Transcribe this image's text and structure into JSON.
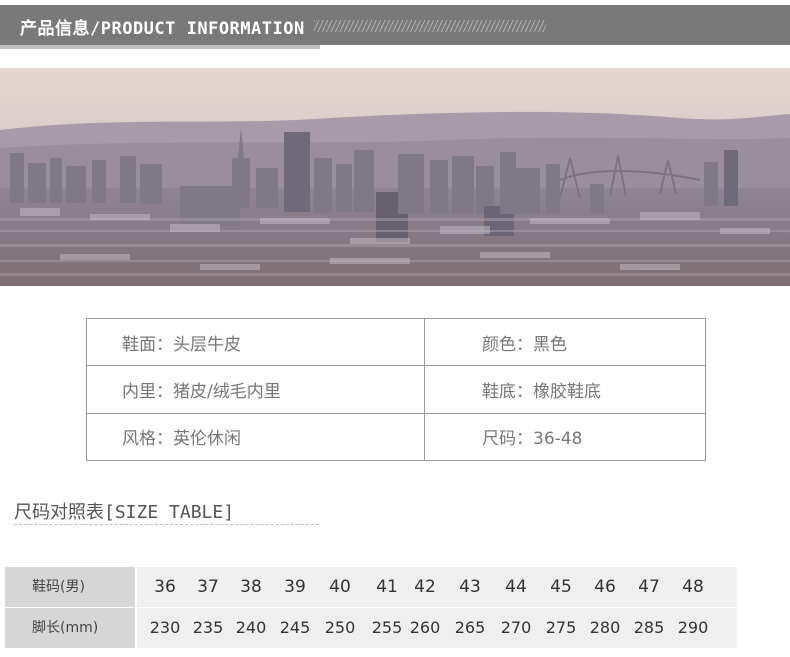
{
  "header": {
    "title": "产品信息/PRODUCT INFORMATION"
  },
  "info": {
    "rows": [
      {
        "left": "鞋面：头层牛皮",
        "right": "颜色：黑色"
      },
      {
        "left": "内里：猪皮/绒毛内里",
        "right": "鞋底：橡胶鞋底"
      },
      {
        "left": "风格：英伦休闲",
        "right": "尺码：36-48"
      }
    ]
  },
  "size_table": {
    "title": "尺码对照表[SIZE TABLE]",
    "row1_label": "鞋码(男)",
    "row2_label": "脚长(mm)",
    "sizes": [
      "36",
      "37",
      "38",
      "39",
      "40",
      "41",
      "42",
      "43",
      "44",
      "45",
      "46",
      "47",
      "48"
    ],
    "lengths": [
      "230",
      "235",
      "240",
      "245",
      "250",
      "255",
      "260",
      "265",
      "270",
      "275",
      "280",
      "285",
      "290"
    ]
  }
}
